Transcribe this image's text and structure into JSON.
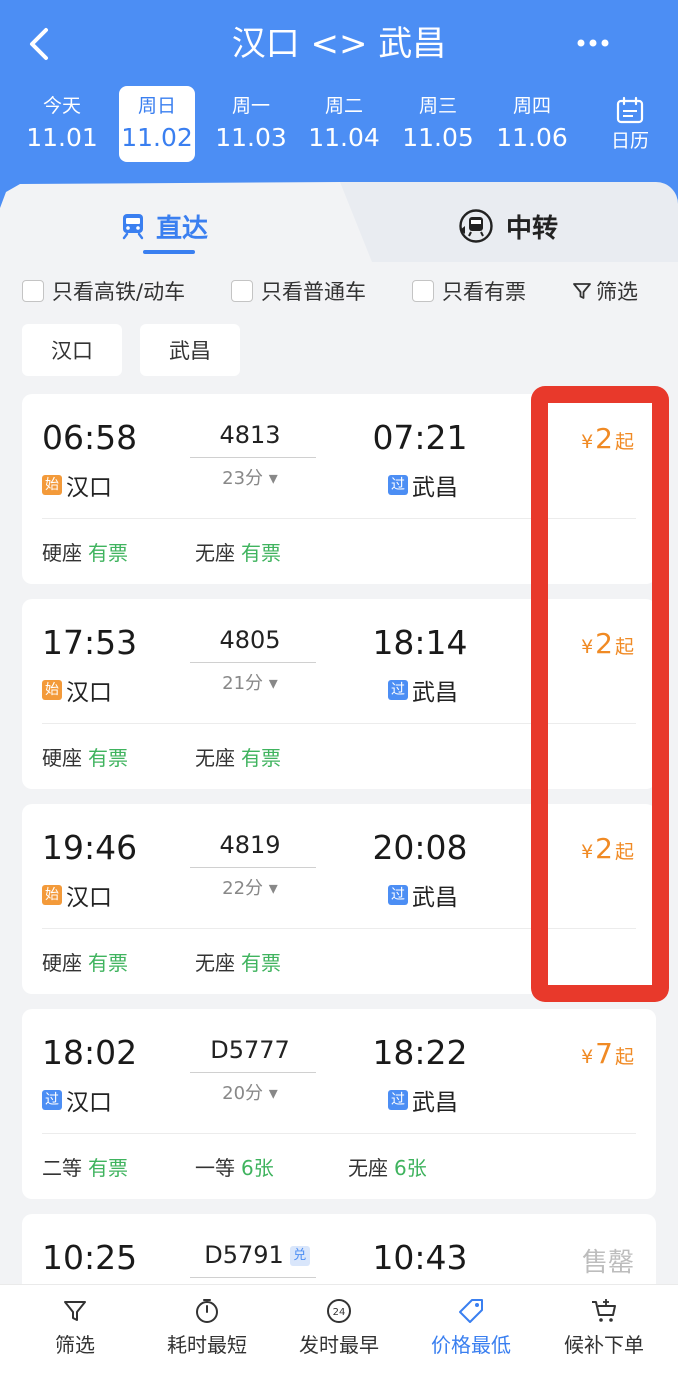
{
  "header": {
    "title": "汉口 <> 武昌"
  },
  "dates": [
    {
      "weekday": "今天",
      "date": "11.01"
    },
    {
      "weekday": "周日",
      "date": "11.02"
    },
    {
      "weekday": "周一",
      "date": "11.03"
    },
    {
      "weekday": "周二",
      "date": "11.04"
    },
    {
      "weekday": "周三",
      "date": "11.05"
    },
    {
      "weekday": "周四",
      "date": "11.06"
    }
  ],
  "selected_date_index": 1,
  "calendar_label": "日历",
  "tabs": {
    "direct": "直达",
    "transfer": "中转"
  },
  "filters": {
    "high_speed": "只看高铁/动车",
    "normal": "只看普通车",
    "available": "只看有票",
    "filter": "筛选"
  },
  "stations": {
    "from": "汉口",
    "to": "武昌"
  },
  "trains": [
    {
      "dep_time": "06:58",
      "train_no": "4813",
      "duration": "23分",
      "arr_time": "07:21",
      "dep_badge": "始",
      "dep_station": "汉口",
      "arr_badge": "过",
      "arr_station": "武昌",
      "price_symbol": "¥",
      "price": "2",
      "price_suffix": "起",
      "seats": [
        {
          "type": "硬座",
          "status": "有票"
        },
        {
          "type": "无座",
          "status": "有票"
        }
      ]
    },
    {
      "dep_time": "17:53",
      "train_no": "4805",
      "duration": "21分",
      "arr_time": "18:14",
      "dep_badge": "始",
      "dep_station": "汉口",
      "arr_badge": "过",
      "arr_station": "武昌",
      "price_symbol": "¥",
      "price": "2",
      "price_suffix": "起",
      "seats": [
        {
          "type": "硬座",
          "status": "有票"
        },
        {
          "type": "无座",
          "status": "有票"
        }
      ]
    },
    {
      "dep_time": "19:46",
      "train_no": "4819",
      "duration": "22分",
      "arr_time": "20:08",
      "dep_badge": "始",
      "dep_station": "汉口",
      "arr_badge": "过",
      "arr_station": "武昌",
      "price_symbol": "¥",
      "price": "2",
      "price_suffix": "起",
      "seats": [
        {
          "type": "硬座",
          "status": "有票"
        },
        {
          "type": "无座",
          "status": "有票"
        }
      ]
    },
    {
      "dep_time": "18:02",
      "train_no": "D5777",
      "duration": "20分",
      "arr_time": "18:22",
      "dep_badge": "过",
      "dep_station": "汉口",
      "arr_badge": "过",
      "arr_station": "武昌",
      "price_symbol": "¥",
      "price": "7",
      "price_suffix": "起",
      "seats": [
        {
          "type": "二等",
          "status": "有票"
        },
        {
          "type": "一等",
          "status": "6张"
        },
        {
          "type": "无座",
          "status": "6张"
        }
      ]
    },
    {
      "dep_time": "10:25",
      "train_no": "D5791",
      "train_badge": "兑",
      "arr_time": "10:43",
      "status": "售罄"
    }
  ],
  "bottom_bar": [
    {
      "label": "筛选",
      "icon": "funnel-icon"
    },
    {
      "label": "耗时最短",
      "icon": "timer-icon"
    },
    {
      "label": "发时最早",
      "icon": "clock-24-icon"
    },
    {
      "label": "价格最低",
      "icon": "price-tag-icon"
    },
    {
      "label": "候补下单",
      "icon": "cart-add-icon"
    }
  ],
  "active_sort_index": 3,
  "colors": {
    "header_bg": "#4c8ef4",
    "accent": "#3a7ff0",
    "price": "#f08a24",
    "available": "#3fb35e",
    "highlight": "#e8392b",
    "badge_start": "#f39a3a",
    "badge_pass": "#4c8ef4"
  }
}
